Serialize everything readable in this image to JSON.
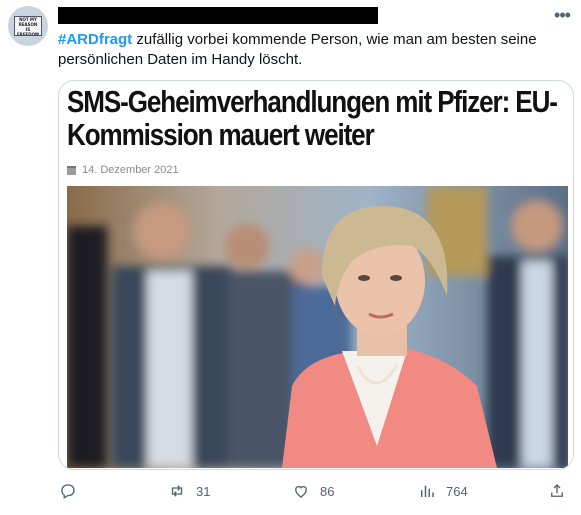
{
  "tweet": {
    "hashtag": "#ARDfragt",
    "text": " zufällig vorbei kommende Person, wie man am besten seine persönlichen Daten im Handy löscht."
  },
  "avatar": {
    "lines": [
      "NOT MY",
      "REASON",
      "IS FREEDOM"
    ]
  },
  "card": {
    "headline": "SMS-Geheimverhandlungen mit Pfizer: EU-Kommission mauert weiter",
    "date": "14. Dezember 2021"
  },
  "actions": {
    "reply": "",
    "retweets": "31",
    "likes": "86",
    "views": "764"
  },
  "colors": {
    "hashtag": "#1d9bf0",
    "muted": "#536471",
    "border": "#cfd9de"
  },
  "icons": [
    "more-icon",
    "reply-icon",
    "retweet-icon",
    "like-icon",
    "views-icon",
    "share-icon",
    "calendar-icon"
  ]
}
